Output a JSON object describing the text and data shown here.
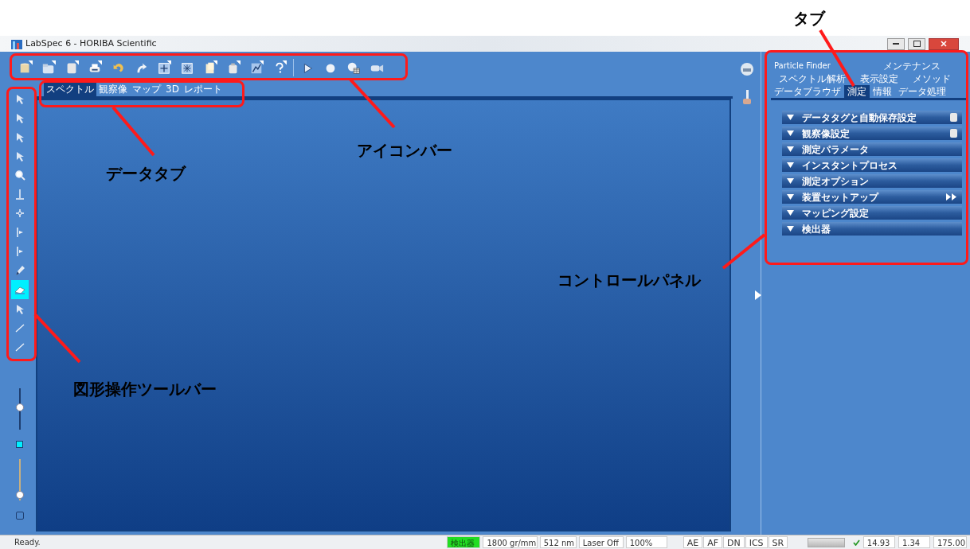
{
  "window": {
    "title": "LabSpec 6 - HORIBA Scientific"
  },
  "data_tabs": [
    {
      "label": "スペクトル",
      "selected": true
    },
    {
      "label": "観察像",
      "selected": false
    },
    {
      "label": "マップ",
      "selected": false
    },
    {
      "label": "3D",
      "selected": false
    },
    {
      "label": "レポート",
      "selected": false
    }
  ],
  "shape_toolbar": [
    {
      "selected": false
    },
    {
      "selected": false
    },
    {
      "selected": false
    },
    {
      "selected": false
    },
    {
      "selected": false
    },
    {
      "selected": false
    },
    {
      "selected": false
    },
    {
      "selected": false
    },
    {
      "selected": false
    },
    {
      "selected": false
    },
    {
      "selected": true
    },
    {
      "selected": false
    },
    {
      "selected": false
    },
    {
      "selected": false
    }
  ],
  "left_controls": {
    "upper_slider": {
      "level": 0.55
    },
    "lower_slider": {
      "level": 0.05
    },
    "checkbox": {
      "checked": false
    }
  },
  "control_panel": {
    "tab_rows": [
      [
        {
          "label": "Particle Finder",
          "selected": false
        },
        {
          "label": "メンテナンス",
          "selected": false
        }
      ],
      [
        {
          "label": "スペクトル解析",
          "selected": false
        },
        {
          "label": "表示設定",
          "selected": false
        },
        {
          "label": "メソッド",
          "selected": false
        }
      ],
      [
        {
          "label": "データブラウザ",
          "selected": false
        },
        {
          "label": "測定",
          "selected": true
        },
        {
          "label": "情報",
          "selected": false
        },
        {
          "label": "データ処理",
          "selected": false
        }
      ]
    ],
    "sections": [
      {
        "label": "データタグと自動保存設定",
        "kind": "badge"
      },
      {
        "label": "観察像設定",
        "kind": "badge"
      },
      {
        "label": "測定パラメータ",
        "kind": "plain"
      },
      {
        "label": "インスタントプロセス",
        "kind": "plain"
      },
      {
        "label": "測定オプション",
        "kind": "plain"
      },
      {
        "label": "装置セットアップ",
        "kind": "arrows"
      },
      {
        "label": "マッピング設定",
        "kind": "plain"
      },
      {
        "label": "検出器",
        "kind": "plain"
      }
    ]
  },
  "status_bar": {
    "message": "Ready.",
    "fields": [
      {
        "text": "検出器",
        "highlighted": true
      },
      {
        "text": "1800 gr/mm",
        "highlighted": false
      },
      {
        "text": "512 nm",
        "highlighted": false
      },
      {
        "text": "Laser Off",
        "highlighted": false
      },
      {
        "text": "100%",
        "highlighted": false
      }
    ],
    "flags": [
      "AE",
      "AF",
      "DN",
      "ICS",
      "SR"
    ],
    "progress": {
      "level": 0
    },
    "readings": [
      "14.93",
      "1.34",
      "175.00"
    ]
  },
  "annotations": [
    {
      "label": "タブ"
    },
    {
      "label": "アイコンバー"
    },
    {
      "label": "データタブ"
    },
    {
      "label": "コントロールパネル"
    },
    {
      "label": "図形操作ツールバー"
    }
  ]
}
